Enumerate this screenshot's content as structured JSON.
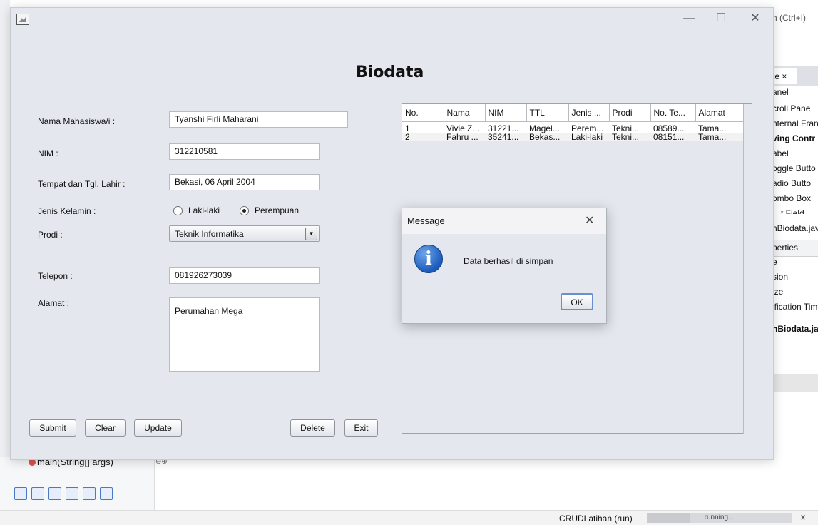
{
  "ide": {
    "search_hint": "h (Ctrl+I)",
    "right_tab": "te ×",
    "palette_items": [
      "anel",
      "croll Pane",
      "nternal Fran",
      "ving Contr",
      "abel",
      "oggle Butto",
      "adio Butto",
      "ombo Box",
      "…t Field"
    ],
    "file_name": "nBiodata.jav",
    "properties_header": "perties",
    "properties_items": [
      "e",
      "sion",
      "ize",
      "ification Tim"
    ],
    "file_name_bold": "nBiodata.ja",
    "navigator_item": "main(String[] args)",
    "run_label": "CRUDLatihan (run)",
    "progress_label": "running...",
    "progress_fraction": 0.3,
    "status_close": "×"
  },
  "window": {
    "controls": {
      "minimize": "—",
      "maximize": "☐",
      "close": "✕"
    },
    "heading": "Biodata",
    "form": {
      "nama_label": "Nama Mahasiswa/i :",
      "nama_value": "Tyanshi Firli Maharani",
      "nim_label": "NIM :",
      "nim_value": "312210581",
      "ttl_label": "Tempat dan Tgl. Lahir :",
      "ttl_value": "Bekasi, 06 April 2004",
      "jk_label": "Jenis Kelamin :",
      "jk_option_male": "Laki-laki",
      "jk_option_female": "Perempuan",
      "jk_selected": "Perempuan",
      "prodi_label": "Prodi :",
      "prodi_value": "Teknik Informatika",
      "telepon_label": "Telepon :",
      "telepon_value": "081926273039",
      "alamat_label": "Alamat :",
      "alamat_value": "Perumahan Mega"
    },
    "buttons": {
      "submit": "Submit",
      "clear": "Clear",
      "update": "Update",
      "delete": "Delete",
      "exit": "Exit"
    },
    "table": {
      "columns": [
        "No.",
        "Nama",
        "NIM",
        "TTL",
        "Jenis ...",
        "Prodi",
        "No. Te...",
        "Alamat"
      ],
      "rows": [
        [
          "1",
          "Vivie Z...",
          "31221...",
          "Magel...",
          "Perem...",
          "Tekni...",
          "08589...",
          "Tama..."
        ],
        [
          "2",
          "Fahru ...",
          "35241...",
          "Bekas...",
          "Laki-laki",
          "Tekni...",
          "08151...",
          "Tama..."
        ]
      ]
    }
  },
  "dialog": {
    "title": "Message",
    "close": "✕",
    "icon": "info-icon",
    "icon_glyph": "i",
    "message": "Data berhasil di simpan",
    "ok": "OK"
  }
}
